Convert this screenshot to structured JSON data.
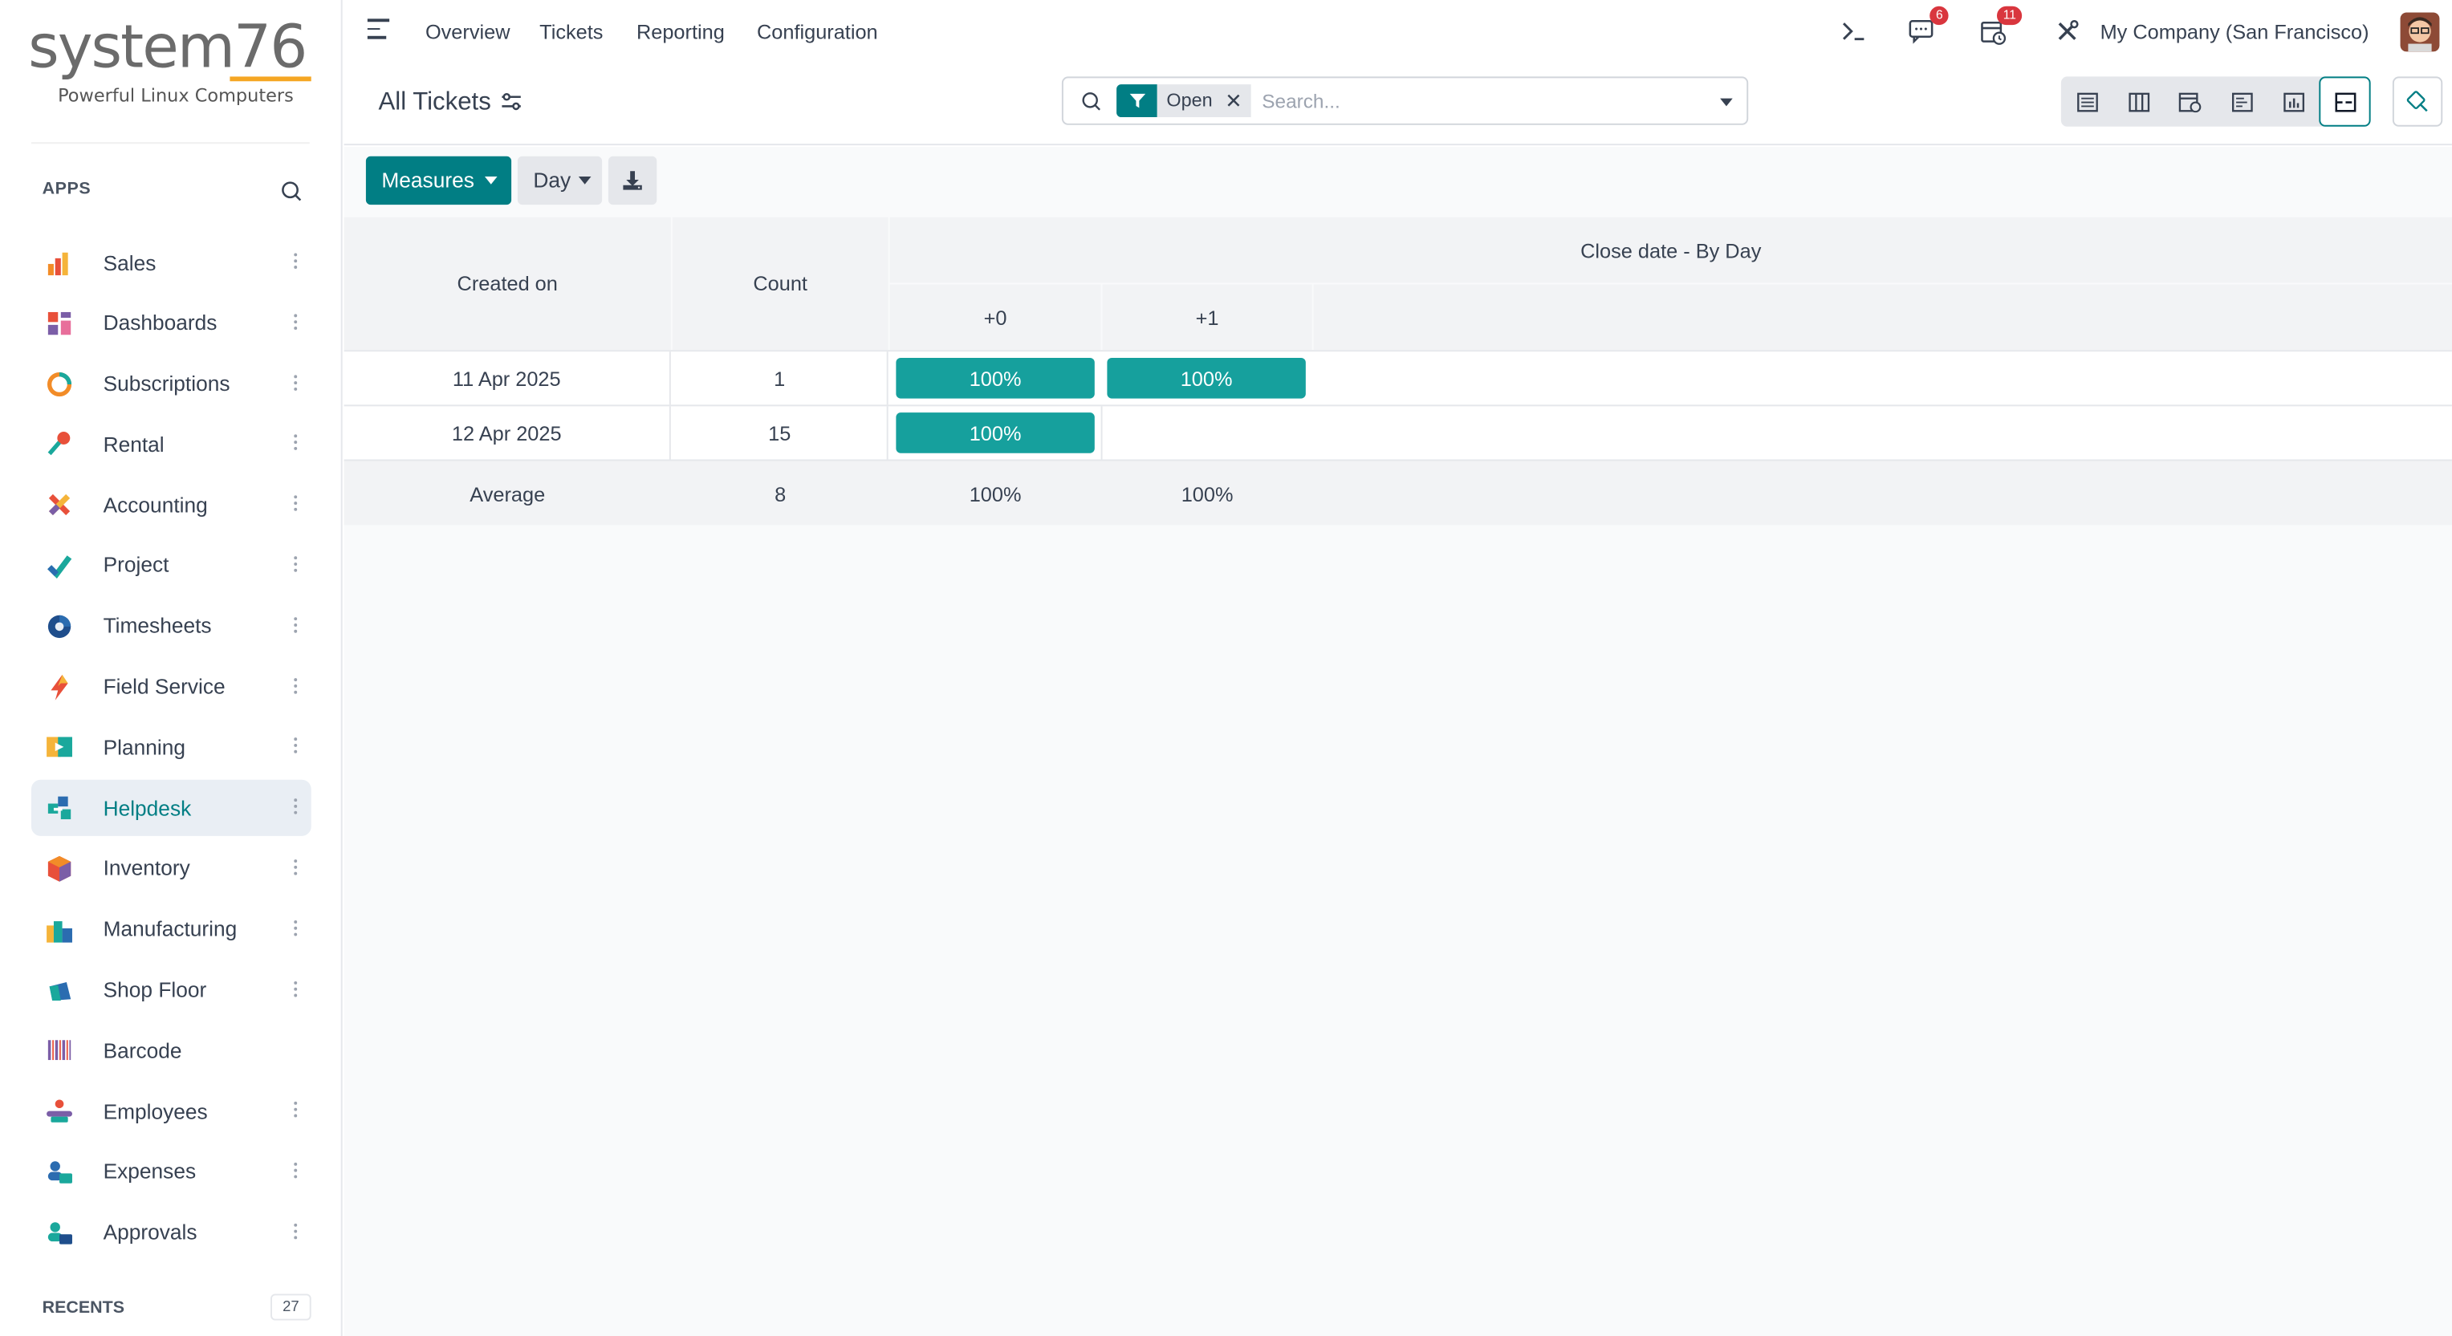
{
  "brand": {
    "name": "system76",
    "tagline": "Powerful Linux Computers"
  },
  "sidebar": {
    "apps_header": "APPS",
    "items": [
      {
        "label": "Sales",
        "icon": "sales-icon",
        "kebab": true
      },
      {
        "label": "Dashboards",
        "icon": "dashboards-icon",
        "kebab": true
      },
      {
        "label": "Subscriptions",
        "icon": "subscriptions-icon",
        "kebab": true
      },
      {
        "label": "Rental",
        "icon": "rental-icon",
        "kebab": true
      },
      {
        "label": "Accounting",
        "icon": "accounting-icon",
        "kebab": true
      },
      {
        "label": "Project",
        "icon": "project-icon",
        "kebab": true
      },
      {
        "label": "Timesheets",
        "icon": "timesheets-icon",
        "kebab": true
      },
      {
        "label": "Field Service",
        "icon": "field-service-icon",
        "kebab": true
      },
      {
        "label": "Planning",
        "icon": "planning-icon",
        "kebab": true
      },
      {
        "label": "Helpdesk",
        "icon": "helpdesk-icon",
        "kebab": true,
        "active": true
      },
      {
        "label": "Inventory",
        "icon": "inventory-icon",
        "kebab": true
      },
      {
        "label": "Manufacturing",
        "icon": "manufacturing-icon",
        "kebab": true
      },
      {
        "label": "Shop Floor",
        "icon": "shop-floor-icon",
        "kebab": true
      },
      {
        "label": "Barcode",
        "icon": "barcode-icon",
        "kebab": false
      },
      {
        "label": "Employees",
        "icon": "employees-icon",
        "kebab": true
      },
      {
        "label": "Expenses",
        "icon": "expenses-icon",
        "kebab": true
      },
      {
        "label": "Approvals",
        "icon": "approvals-icon",
        "kebab": true
      }
    ],
    "recents_label": "RECENTS",
    "recents_count": "27"
  },
  "navbar": {
    "menu": [
      "Overview",
      "Tickets",
      "Reporting",
      "Configuration"
    ],
    "messages_badge": "6",
    "activities_badge": "11",
    "company": "My Company (San Francisco)"
  },
  "control": {
    "breadcrumb": "All Tickets",
    "facet_value": "Open",
    "search_placeholder": "Search..."
  },
  "toolbar": {
    "measures_label": "Measures",
    "interval_label": "Day"
  },
  "cohort": {
    "col_created": "Created on",
    "col_count": "Count",
    "col_group": "Close date - By Day",
    "intervals": [
      "+0",
      "+1"
    ],
    "rows": [
      {
        "date": "11 Apr 2025",
        "count": "1",
        "values": [
          "100%",
          "100%"
        ]
      },
      {
        "date": "12 Apr 2025",
        "count": "15",
        "values": [
          "100%",
          ""
        ]
      }
    ],
    "average": {
      "label": "Average",
      "count": "8",
      "values": [
        "100%",
        "100%"
      ]
    }
  },
  "colors": {
    "accent": "#017e84",
    "cohort_fill": "#16a09d",
    "badge": "#d9363e"
  }
}
